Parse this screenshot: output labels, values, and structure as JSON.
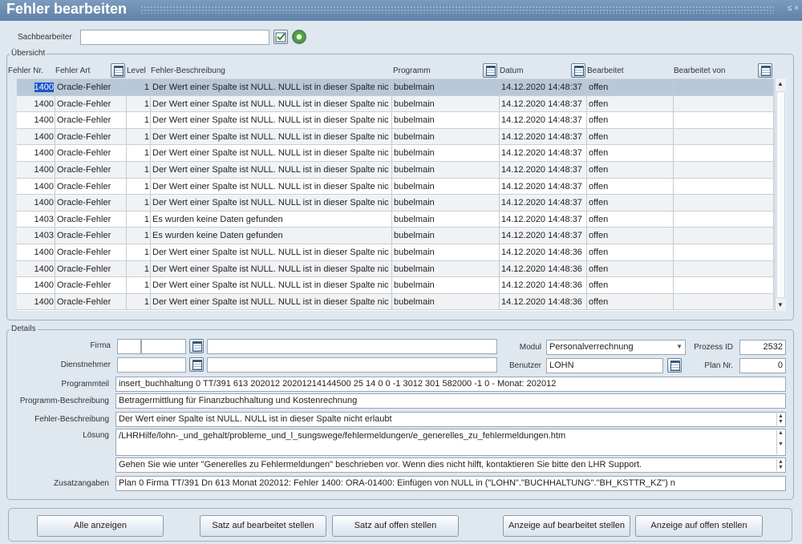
{
  "window": {
    "title": "Fehler bearbeiten",
    "controls": "≤ ×"
  },
  "sachbearbeiter": {
    "label": "Sachbearbeiter",
    "value": ""
  },
  "uebersicht": {
    "legend": "Übersicht",
    "columns": {
      "fehler_nr": "Fehler Nr.",
      "fehler_art": "Fehler Art",
      "level": "Level",
      "beschreibung": "Fehler-Beschreibung",
      "programm": "Programm",
      "datum": "Datum",
      "bearbeitet": "Bearbeitet",
      "bearbeitet_von": "Bearbeitet von"
    },
    "rows": [
      {
        "nr": "1400",
        "art": "Oracle-Fehler",
        "level": "1",
        "desc": "Der Wert einer Spalte ist NULL. NULL ist in dieser Spalte nic",
        "prog": "bubelmain",
        "datum": "14.12.2020 14:48:37",
        "bearb": "offen",
        "von": ""
      },
      {
        "nr": "1400",
        "art": "Oracle-Fehler",
        "level": "1",
        "desc": "Der Wert einer Spalte ist NULL. NULL ist in dieser Spalte nic",
        "prog": "bubelmain",
        "datum": "14.12.2020 14:48:37",
        "bearb": "offen",
        "von": ""
      },
      {
        "nr": "1400",
        "art": "Oracle-Fehler",
        "level": "1",
        "desc": "Der Wert einer Spalte ist NULL. NULL ist in dieser Spalte nic",
        "prog": "bubelmain",
        "datum": "14.12.2020 14:48:37",
        "bearb": "offen",
        "von": ""
      },
      {
        "nr": "1400",
        "art": "Oracle-Fehler",
        "level": "1",
        "desc": "Der Wert einer Spalte ist NULL. NULL ist in dieser Spalte nic",
        "prog": "bubelmain",
        "datum": "14.12.2020 14:48:37",
        "bearb": "offen",
        "von": ""
      },
      {
        "nr": "1400",
        "art": "Oracle-Fehler",
        "level": "1",
        "desc": "Der Wert einer Spalte ist NULL. NULL ist in dieser Spalte nic",
        "prog": "bubelmain",
        "datum": "14.12.2020 14:48:37",
        "bearb": "offen",
        "von": ""
      },
      {
        "nr": "1400",
        "art": "Oracle-Fehler",
        "level": "1",
        "desc": "Der Wert einer Spalte ist NULL. NULL ist in dieser Spalte nic",
        "prog": "bubelmain",
        "datum": "14.12.2020 14:48:37",
        "bearb": "offen",
        "von": ""
      },
      {
        "nr": "1400",
        "art": "Oracle-Fehler",
        "level": "1",
        "desc": "Der Wert einer Spalte ist NULL. NULL ist in dieser Spalte nic",
        "prog": "bubelmain",
        "datum": "14.12.2020 14:48:37",
        "bearb": "offen",
        "von": ""
      },
      {
        "nr": "1400",
        "art": "Oracle-Fehler",
        "level": "1",
        "desc": "Der Wert einer Spalte ist NULL. NULL ist in dieser Spalte nic",
        "prog": "bubelmain",
        "datum": "14.12.2020 14:48:37",
        "bearb": "offen",
        "von": ""
      },
      {
        "nr": "1403",
        "art": "Oracle-Fehler",
        "level": "1",
        "desc": "Es wurden keine Daten gefunden",
        "prog": "bubelmain",
        "datum": "14.12.2020 14:48:37",
        "bearb": "offen",
        "von": ""
      },
      {
        "nr": "1403",
        "art": "Oracle-Fehler",
        "level": "1",
        "desc": "Es wurden keine Daten gefunden",
        "prog": "bubelmain",
        "datum": "14.12.2020 14:48:37",
        "bearb": "offen",
        "von": ""
      },
      {
        "nr": "1400",
        "art": "Oracle-Fehler",
        "level": "1",
        "desc": "Der Wert einer Spalte ist NULL. NULL ist in dieser Spalte nic",
        "prog": "bubelmain",
        "datum": "14.12.2020 14:48:36",
        "bearb": "offen",
        "von": ""
      },
      {
        "nr": "1400",
        "art": "Oracle-Fehler",
        "level": "1",
        "desc": "Der Wert einer Spalte ist NULL. NULL ist in dieser Spalte nic",
        "prog": "bubelmain",
        "datum": "14.12.2020 14:48:36",
        "bearb": "offen",
        "von": ""
      },
      {
        "nr": "1400",
        "art": "Oracle-Fehler",
        "level": "1",
        "desc": "Der Wert einer Spalte ist NULL. NULL ist in dieser Spalte nic",
        "prog": "bubelmain",
        "datum": "14.12.2020 14:48:36",
        "bearb": "offen",
        "von": ""
      },
      {
        "nr": "1400",
        "art": "Oracle-Fehler",
        "level": "1",
        "desc": "Der Wert einer Spalte ist NULL. NULL ist in dieser Spalte nic",
        "prog": "bubelmain",
        "datum": "14.12.2020 14:48:36",
        "bearb": "offen",
        "von": ""
      }
    ]
  },
  "details": {
    "legend": "Details",
    "firma": {
      "label": "Firma",
      "value1": "",
      "value2": "",
      "name": ""
    },
    "dienstnehmer": {
      "label": "Dienstnehmer",
      "value": "",
      "name": ""
    },
    "modul": {
      "label": "Modul",
      "value": "Personalverrechnung"
    },
    "prozess_id": {
      "label": "Prozess ID",
      "value": "2532"
    },
    "benutzer": {
      "label": "Benutzer",
      "value": "LOHN"
    },
    "plan_nr": {
      "label": "Plan Nr.",
      "value": "0"
    },
    "programmteil": {
      "label": "Programmteil",
      "value": "insert_buchhaltung 0 TT/391 613 202012 20201214144500 25 14 0  0 -1 3012 301 582000 -1 0 - Monat: 202012"
    },
    "programm_beschreibung": {
      "label": "Programm-Beschreibung",
      "value": "Betragermittlung für Finanzbuchhaltung und Kostenrechnung"
    },
    "fehler_beschreibung": {
      "label": "Fehler-Beschreibung",
      "value": "Der Wert einer Spalte ist NULL. NULL ist in dieser Spalte nicht erlaubt"
    },
    "loesung": {
      "label": "Lösung",
      "value": "/LHRHilfe/lohn-_und_gehalt/probleme_und_l_sungswege/fehlermeldungen/e_generelles_zu_fehlermeldungen.htm"
    },
    "hinweis": "Gehen Sie wie unter \"Generelles zu Fehlermeldungen\" beschrieben vor. Wenn dies nicht hilft, kontaktieren Sie bitte den LHR Support.",
    "zusatzangaben": {
      "label": "Zusatzangaben",
      "value": "Plan 0 Firma TT/391  Dn 613 Monat 202012: Fehler 1400: ORA-01400: Einfügen von NULL in (\"LOHN\".\"BUCHHALTUNG\".\"BH_KSTTR_KZ\") n"
    }
  },
  "buttons": {
    "alle_anzeigen": "Alle anzeigen",
    "satz_bearbeitet": "Satz auf bearbeitet stellen",
    "satz_offen": "Satz auf offen stellen",
    "anzeige_bearbeitet": "Anzeige auf bearbeitet stellen",
    "anzeige_offen": "Anzeige auf offen stellen"
  },
  "colors": {
    "titlebar": "#6f8fb1",
    "selection": "#1c56c8",
    "selected_row": "#b8c8d8"
  }
}
